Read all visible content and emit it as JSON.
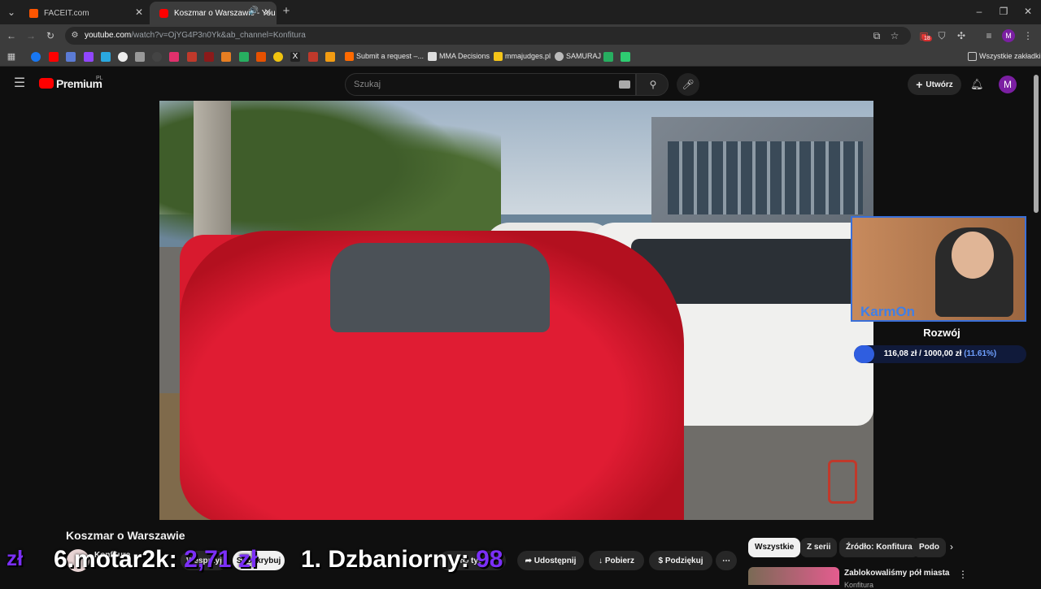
{
  "browser": {
    "tabs": [
      {
        "title": "FACEIT.com",
        "active": false
      },
      {
        "title": "Koszmar o Warszawie - You",
        "active": true
      }
    ],
    "url": {
      "host": "youtube.com",
      "path": "/watch?v=OjYG4P3n0Yk&ab_channel=Konfitura"
    },
    "extensions_badge": "18",
    "profile_initial": "M",
    "bookmarks": [
      {
        "label": "Submit a request –...",
        "color": "#ff6a00"
      },
      {
        "label": "MMA Decisions",
        "color": "#f1f1f1"
      },
      {
        "label": "mmajudges.pl",
        "color": "#f5c518"
      },
      {
        "label": "SAMURAJ",
        "color": "#bbbbbb"
      }
    ],
    "all_bookmarks": "Wszystkie zakładki"
  },
  "youtube": {
    "logo_text": "Premium",
    "logo_region": "PL",
    "search_placeholder": "Szukaj",
    "create_label": "Utwórz",
    "avatar_initial": "M"
  },
  "video": {
    "title": "Koszmar o Warszawie",
    "channel": "Konfitura",
    "join_label": "Wesprzyj",
    "subscribe_label": "Subskrybuj",
    "share_label": "Udostępnij",
    "download_label": "Pobierz",
    "thanks_label": "Podziękuj",
    "likes_label": "tys."
  },
  "stream_overlay": {
    "webcam_name": "KarmOn",
    "goal_title": "Rozwój",
    "goal_current": "116,08 zł",
    "goal_sep": "/",
    "goal_target": "1000,00 zł",
    "goal_percent": "(11.61%)",
    "goal_fraction": 0.1161,
    "donation_left_rank": "6.",
    "donation_left_name": "motar2k:",
    "donation_left_value": "2,71 zł",
    "donation_right_rank": "1.",
    "donation_right_name": "Dzbaniorny:",
    "donation_right_value": "98",
    "currency_symbol": "zł"
  },
  "sidebar": {
    "chips": [
      "Wszystkie",
      "Z serii",
      "Źródło: Konfitura",
      "Podo"
    ],
    "recommendation": {
      "title": "Zablokowaliśmy pół miasta",
      "channel": "Konfitura"
    }
  }
}
